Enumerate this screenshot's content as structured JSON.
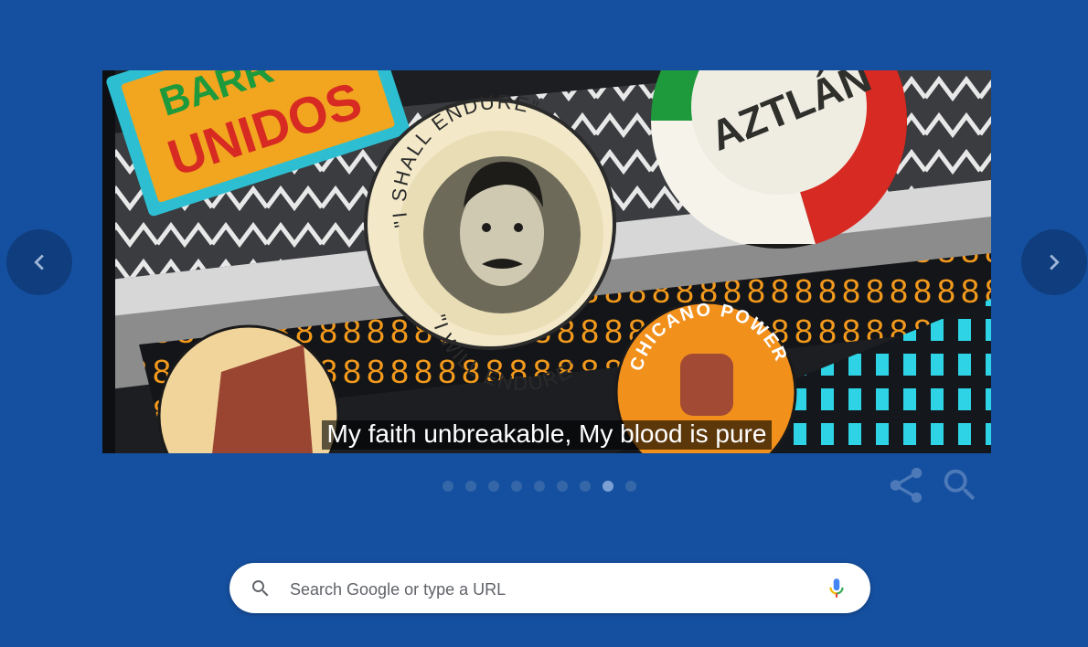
{
  "doodle": {
    "caption": "My faith unbreakable, My blood is pure",
    "buttons": {
      "barrios_text": "UNIDOS",
      "barrios_partial": "BARR",
      "center_top": "\"I SHALL ENDURE\"",
      "center_bottom": "\"I WILL ENDURE\"",
      "aztlan": "AZTLÁN",
      "chicano": "CHICANO POWER"
    }
  },
  "carousel": {
    "total_slides": 9,
    "active_index": 7,
    "prev_icon": "chevron-left-icon",
    "next_icon": "chevron-right-icon"
  },
  "actions": {
    "share_icon": "share-icon",
    "search_icon": "search-icon"
  },
  "search": {
    "placeholder": "Search Google or type a URL",
    "value": "",
    "icon": "search-icon",
    "mic_icon": "mic-icon"
  },
  "colors": {
    "background": "#1550a0",
    "nav_button": "#0f3d7d",
    "dot_inactive": "#3567a8",
    "dot_active": "#7ba1d4"
  }
}
